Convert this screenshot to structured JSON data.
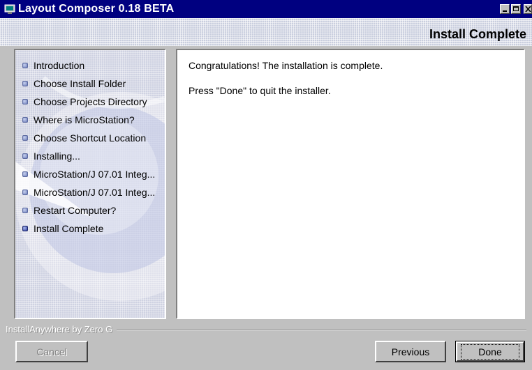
{
  "window": {
    "title": "Layout Composer 0.18 BETA"
  },
  "header": {
    "step_title": "Install Complete"
  },
  "sidebar": {
    "steps": [
      {
        "label": "Introduction",
        "current": false
      },
      {
        "label": "Choose Install Folder",
        "current": false
      },
      {
        "label": "Choose Projects Directory",
        "current": false
      },
      {
        "label": "Where is MicroStation?",
        "current": false
      },
      {
        "label": "Choose Shortcut Location",
        "current": false
      },
      {
        "label": "Installing...",
        "current": false
      },
      {
        "label": "MicroStation/J 07.01 Integ...",
        "current": false
      },
      {
        "label": "MicroStation/J 07.01 Integ...",
        "current": false
      },
      {
        "label": "Restart Computer?",
        "current": false
      },
      {
        "label": "Install Complete",
        "current": true
      }
    ]
  },
  "main": {
    "line1": "Congratulations! The installation is complete.",
    "line2": "Press \"Done\" to quit the installer."
  },
  "footer": {
    "brand": "InstallAnywhere by Zero G",
    "cancel_label": "Cancel",
    "previous_label": "Previous",
    "done_label": "Done"
  },
  "colors": {
    "titlebar": "#000080",
    "header_bg": "#c9cede",
    "window_bg": "#c0c0c0",
    "bullet": "#6a7ab8"
  }
}
